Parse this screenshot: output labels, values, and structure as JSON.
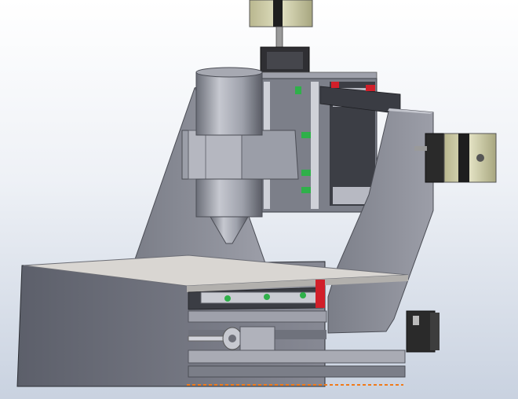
{
  "colors": {
    "bg_top": "#ffffff",
    "bg_bottom": "#c9d2e0",
    "frame": "#8e9099",
    "frame_dark": "#5d5f68",
    "bed_top": "#d9d6d2",
    "motor_body": "#d3d2b0",
    "motor_dark": "#2b2b2b",
    "rail_green": "#2fb04a",
    "stop_red": "#d11f2a",
    "orange_dash": "#f07a1a"
  },
  "icons": {
    "spindle": "spindle-icon",
    "motor": "stepper-motor-icon"
  }
}
